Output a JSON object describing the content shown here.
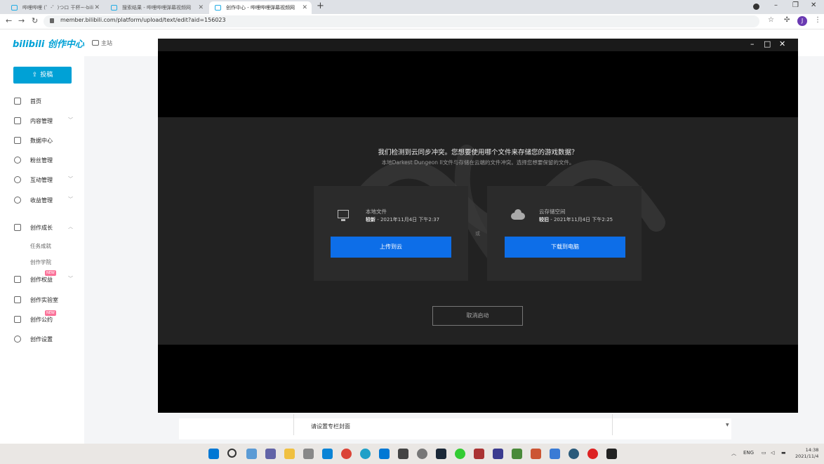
{
  "browser": {
    "tabs": [
      {
        "label": "哔哩哔哩 (゜-゜)つロ 干杯~-bili"
      },
      {
        "label": "搜索结果 - 哔哩哔哩弹幕视频网"
      },
      {
        "label": "创作中心 - 哔哩哔哩弹幕视频网"
      }
    ],
    "url": "member.bilibili.com/platform/upload/text/edit?aid=156023",
    "profile_initial": "J"
  },
  "header": {
    "logo": "bilibili 创作中心",
    "home_link": "主站"
  },
  "sidebar": {
    "upload_label": "投稿",
    "items": [
      {
        "label": "首页"
      },
      {
        "label": "内容管理"
      },
      {
        "label": "数据中心"
      },
      {
        "label": "粉丝管理"
      },
      {
        "label": "互动管理"
      },
      {
        "label": "收益管理"
      },
      {
        "label": "创作成长"
      },
      {
        "label": "创作权益"
      },
      {
        "label": "创作实验室"
      },
      {
        "label": "创作公约"
      },
      {
        "label": "创作设置"
      }
    ],
    "sub_items": [
      {
        "label": "任务成就"
      },
      {
        "label": "创作学院"
      }
    ],
    "new_badge": "NEW"
  },
  "main": {
    "cover_label": "请设置专栏封面"
  },
  "dialog": {
    "title": "我们检测到云同步冲突。您想要使用哪个文件来存储您的游戏数据？",
    "subtitle": "本地Darkest Dungeon II文件与存储在云端的文件冲突。选择您想要保留的文件。",
    "local": {
      "name": "本地文件",
      "status": "较新",
      "time": " - 2021年11月4日 下午2:37",
      "button": "上传到云"
    },
    "or": "或",
    "cloud": {
      "name": "云存储空间",
      "status": "较旧",
      "time": " - 2021年11月4日 下午2:25",
      "button": "下载到电脑"
    },
    "cancel": "取消启动"
  },
  "taskbar": {
    "lang": "ENG",
    "time": "14:38",
    "date": "2021/11/4",
    "accent": "#0d6ee8"
  }
}
